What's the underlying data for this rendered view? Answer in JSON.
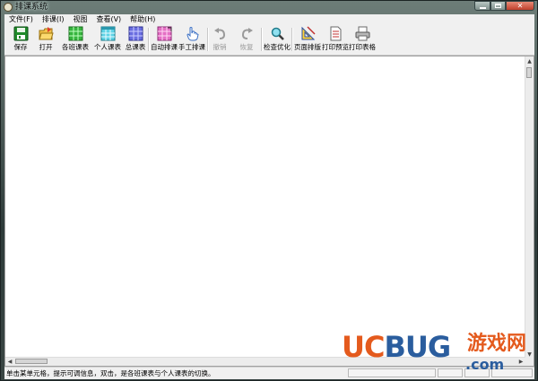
{
  "window": {
    "title": "排课系统"
  },
  "menubar": {
    "items": [
      {
        "label": "文件(F)"
      },
      {
        "label": "排课(I)"
      },
      {
        "label": "视图"
      },
      {
        "label": "查看(V)"
      },
      {
        "label": "帮助(H)"
      }
    ]
  },
  "toolbar": {
    "buttons": [
      {
        "label": "保存",
        "icon": "save-icon",
        "enabled": true
      },
      {
        "label": "打开",
        "icon": "open-icon",
        "enabled": true
      },
      {
        "label": "各班课表",
        "icon": "class-table-icon",
        "enabled": true
      },
      {
        "label": "个人课表",
        "icon": "personal-table-icon",
        "enabled": true
      },
      {
        "label": "总课表",
        "icon": "master-table-icon",
        "enabled": true
      },
      {
        "label": "自动排课",
        "icon": "auto-schedule-icon",
        "enabled": true
      },
      {
        "label": "手工排课",
        "icon": "hand-pointer-icon",
        "enabled": true
      },
      {
        "label": "撤销",
        "icon": "undo-icon",
        "enabled": false
      },
      {
        "label": "恢复",
        "icon": "redo-icon",
        "enabled": false
      },
      {
        "label": "检查优化",
        "icon": "magnifier-icon",
        "enabled": true
      },
      {
        "label": "页面排版",
        "icon": "page-layout-icon",
        "enabled": true
      },
      {
        "label": "打印预览",
        "icon": "print-preview-icon",
        "enabled": true
      },
      {
        "label": "打印表格",
        "icon": "printer-icon",
        "enabled": true
      }
    ]
  },
  "statusbar": {
    "text": "单击某单元格，提示可调信息，双击，是各班课表与个人课表的切换。"
  },
  "watermark": {
    "brand": "UCBUG",
    "brand_cn": "游戏网",
    "domain": ".com"
  },
  "colors": {
    "watermark_orange": "#e45a1d",
    "watermark_blue": "#2a5d9e",
    "chrome": "#f0f0f0"
  }
}
